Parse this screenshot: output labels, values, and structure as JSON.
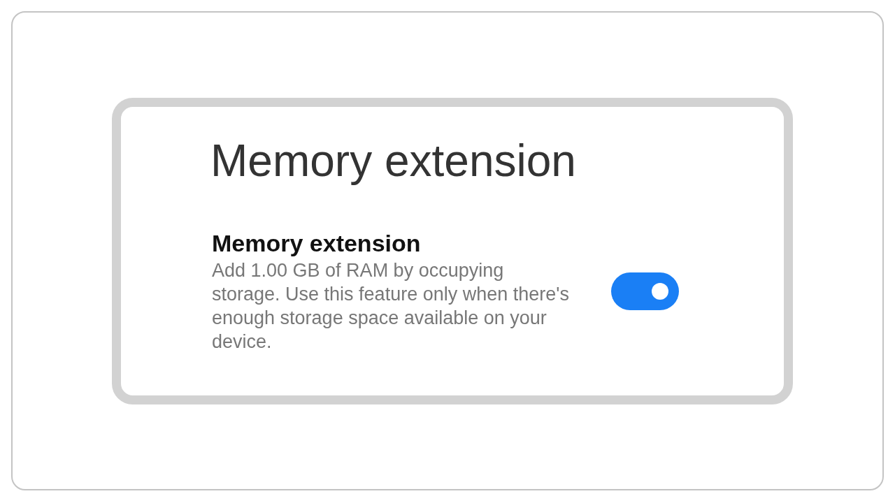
{
  "title": "Memory extension",
  "setting": {
    "label": "Memory extension",
    "description": "Add 1.00 GB of RAM by occupying storage. Use this feature only when there's enough storage space available on your device.",
    "on": true
  }
}
